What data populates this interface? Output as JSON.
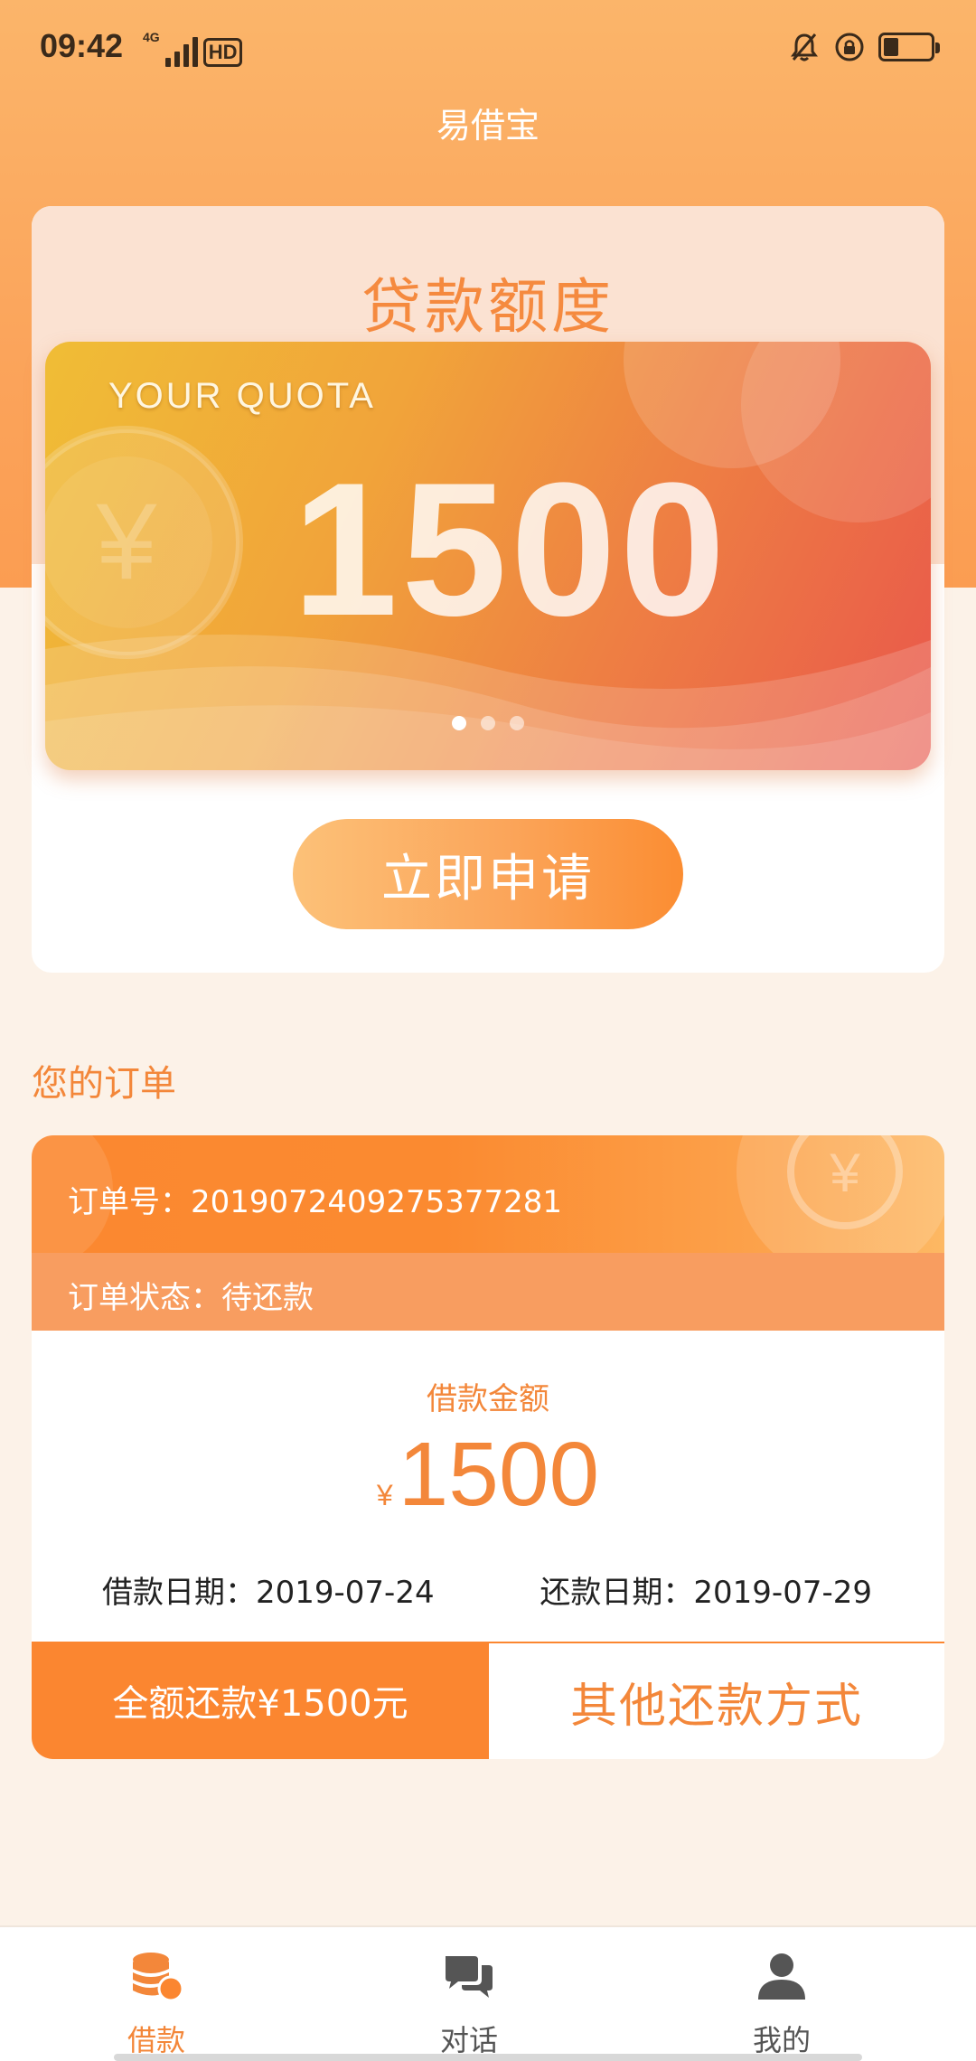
{
  "status_bar": {
    "time": "09:42",
    "network": "4G",
    "hd": "HD"
  },
  "app": {
    "title": "易借宝"
  },
  "quota_card": {
    "heading": "贷款额度",
    "banner": {
      "label": "YOUR QUOTA",
      "amount": "1500",
      "dots_total": 3,
      "dots_active": 1
    },
    "apply_button": "立即申请"
  },
  "orders": {
    "heading": "您的订单",
    "order": {
      "order_no": "订单号：2019072409275377281",
      "status": "订单状态：待还款",
      "loan_label": "借款金额",
      "currency": "¥",
      "amount": "1500",
      "loan_date": "借款日期：2019-07-24",
      "repay_date": "还款日期：2019-07-29",
      "full_repay_button": "全额还款¥1500元",
      "other_repay_button": "其他还款方式"
    }
  },
  "bottom_nav": {
    "items": [
      {
        "label": "借款",
        "icon": "coins-icon",
        "active": true
      },
      {
        "label": "对话",
        "icon": "chat-bubbles-icon",
        "active": false
      },
      {
        "label": "我的",
        "icon": "user-icon",
        "active": false
      }
    ]
  },
  "colors": {
    "accent": "#f3873a",
    "accent_strong": "#fb8630",
    "page_bg": "#fcf2e8"
  }
}
